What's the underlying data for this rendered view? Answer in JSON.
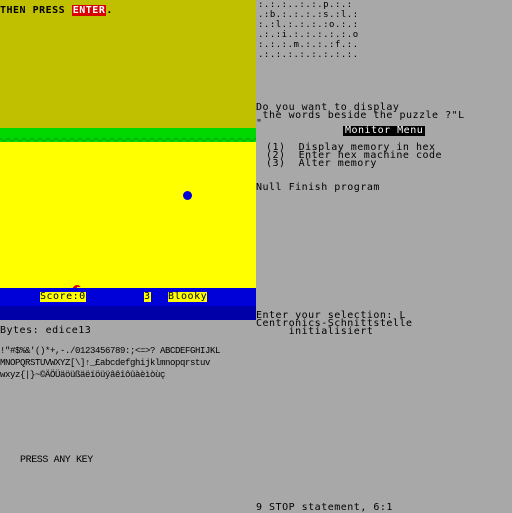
{
  "game": {
    "prompt_prefix": "THEN PRESS ",
    "prompt_key": "ENTER",
    "prompt_suffix": ".",
    "score_label": "Score:0",
    "lives": "3",
    "player_name": "Blooky"
  },
  "loader": {
    "bytes_line": "Bytes: edice13",
    "charset_line1": "!\"#$%&'()*+,-./0123456789:;<=>? ABCDEFGHIJKL",
    "charset_line2": "MNOPQRSTUVWXYZ[\\]↑_£abcdefghijklmnopqrstuv",
    "charset_line3": "wxyz{|}~©ÄÖÜäöüßäëïöüÿâêîôûàèìòùç",
    "press_any_key": "PRESS ANY KEY"
  },
  "puzzle": {
    "row1": ":.:.:..:.:.p.:.:",
    "row2": ".:b.:.:.:.:s.:l.:",
    "row3": ":.:l.:.:.:.:o.:.:",
    "row4": ".:.:i.:.:.:.:.:.o",
    "row5": ":.:.:.m.:.:.:f.:.",
    "row6": ".:.:.:.:.:.:.:.:."
  },
  "monitor": {
    "question_line1": "Do you want to display",
    "question_line2": " the words beside the puzzle ?\"L",
    "question_line3": "\"",
    "menu_title": "Monitor Menu",
    "options": [
      "(1)  Display memory in hex",
      "(2)  Enter hex machine code",
      "(3)  Alter memory"
    ],
    "null_line": "Null Finish program",
    "selection_line": "Enter your selection: L",
    "centronics_line1": "Centronics-Schnittstelle",
    "centronics_line2": "     initialisiert",
    "stop_line": "9 STOP statement, 6:1"
  },
  "colors": {
    "sky": "#c0c000",
    "grass": "#00d800",
    "ground": "#ffff00",
    "status_bar": "#0000d8",
    "background": "#a8a8a8"
  }
}
